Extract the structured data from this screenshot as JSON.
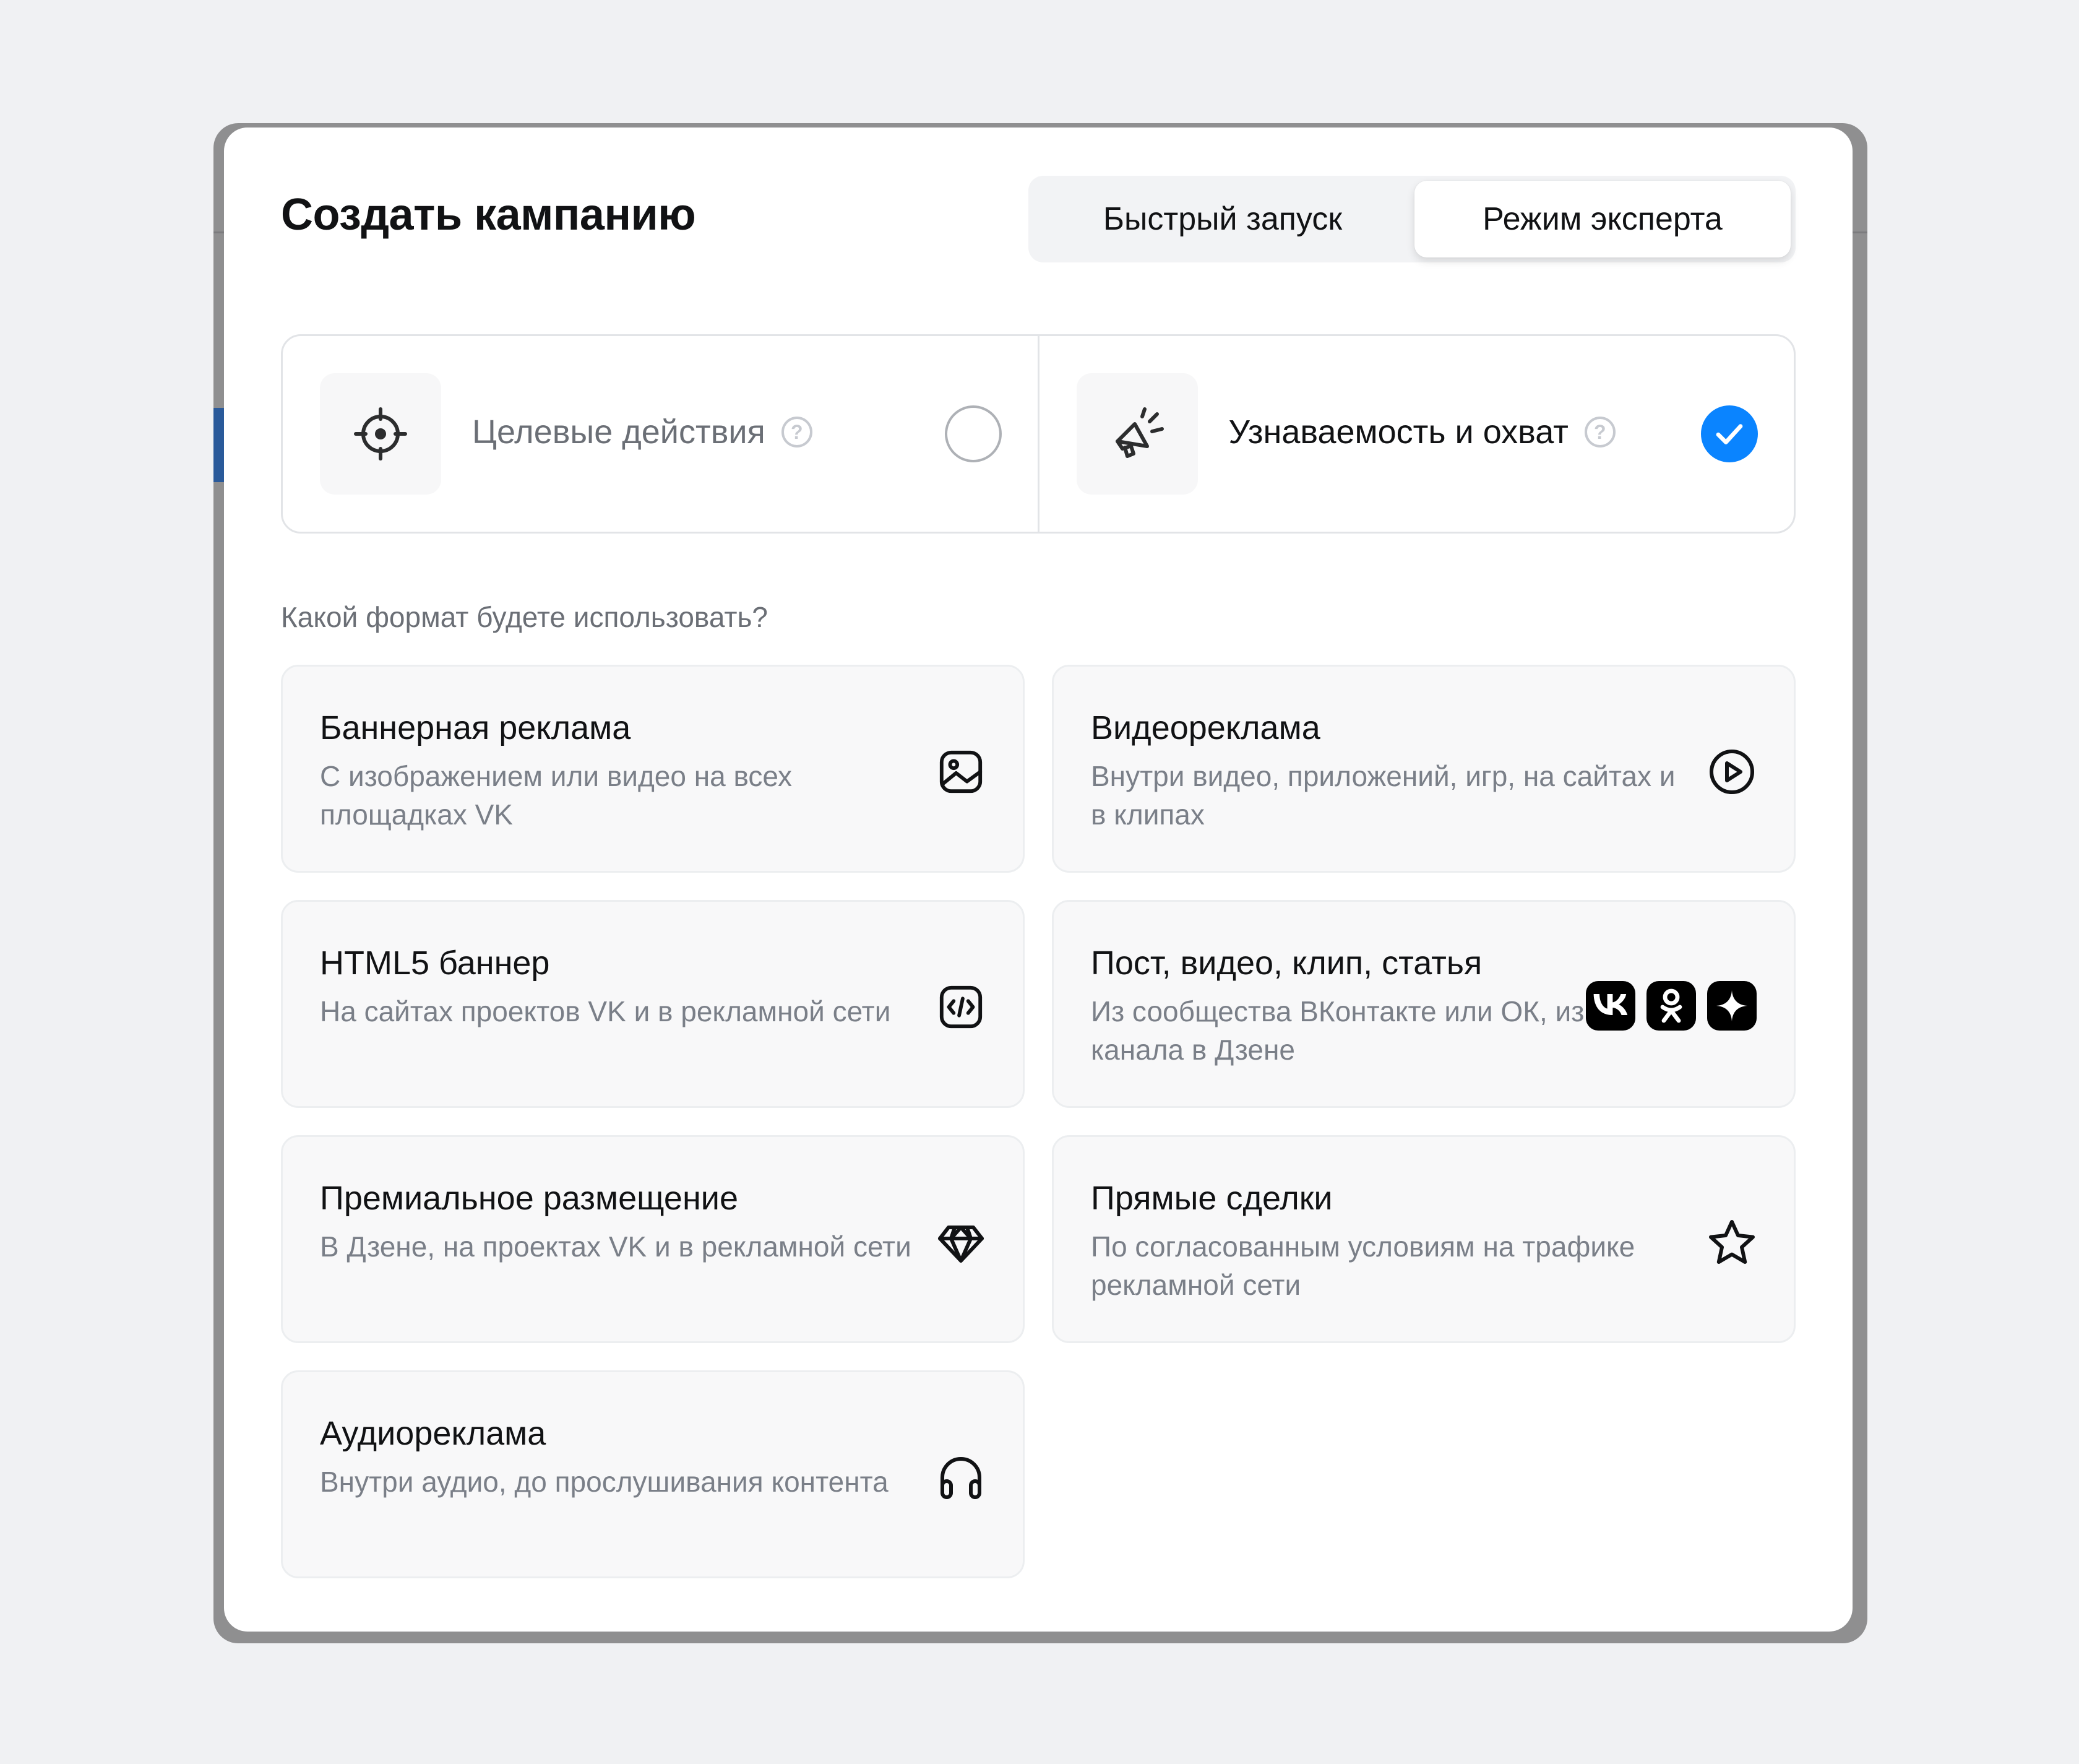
{
  "modal": {
    "title": "Создать кампанию",
    "mode_tabs": [
      {
        "label": "Быстрый запуск",
        "selected": false
      },
      {
        "label": "Режим эксперта",
        "selected": true
      }
    ]
  },
  "goals": [
    {
      "label": "Целевые действия",
      "icon": "target-icon",
      "selected": false
    },
    {
      "label": "Узнаваемость и охват",
      "icon": "megaphone-icon",
      "selected": true
    }
  ],
  "format_question": "Какой формат будете использовать?",
  "formats": [
    {
      "title": "Баннерная реклама",
      "description": "С изображением или видео на всех площадках VK",
      "icon": "image-icon"
    },
    {
      "title": "Видеореклама",
      "description": "Внутри видео, приложений, игр, на сайтах и в клипах",
      "icon": "play-icon"
    },
    {
      "title": "HTML5 баннер",
      "description": "На сайтах проектов VK и в рекламной сети",
      "icon": "code-icon"
    },
    {
      "title": "Пост, видео, клип, статья",
      "description": "Из сообщества ВКонтакте или ОК, из канала в Дзене",
      "icons": [
        "vk-icon",
        "ok-icon",
        "dzen-icon"
      ]
    },
    {
      "title": "Премиальное размещение",
      "description": "В Дзене, на проектах VK и в рекламной сети",
      "icon": "diamond-icon"
    },
    {
      "title": "Прямые сделки",
      "description": "По согласованным условиям на трафике рекламной сети",
      "icon": "star-icon"
    },
    {
      "title": "Аудиореклама",
      "description": "Внутри аудио, до прослушивания контента",
      "icon": "headphones-icon"
    }
  ],
  "colors": {
    "accent": "#0a84ff",
    "text_primary": "#111214",
    "text_secondary": "#7a7f88"
  }
}
